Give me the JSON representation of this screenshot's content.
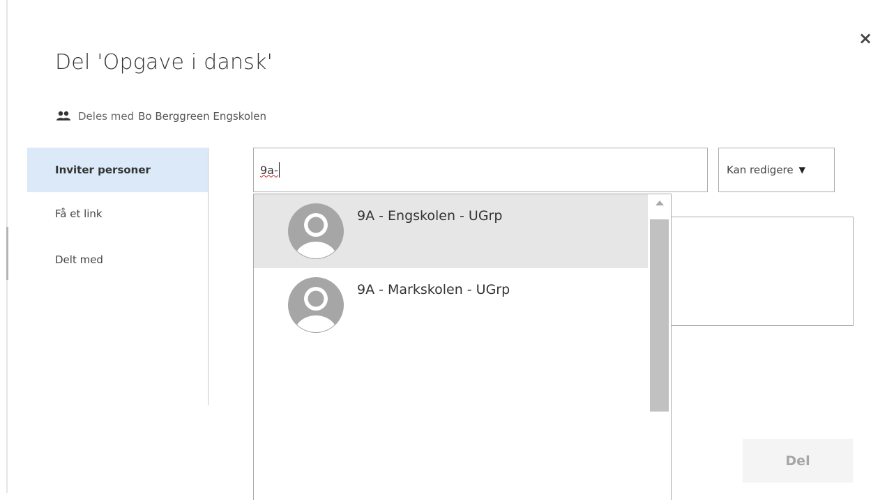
{
  "dialog": {
    "title": "Del 'Opgave i dansk'",
    "close_symbol": "×",
    "shared": {
      "icon": "people-icon",
      "label": "Deles med",
      "owner": "Bo Berggreen Engskolen"
    }
  },
  "nav": {
    "items": [
      {
        "label": "Inviter personer",
        "active": true
      },
      {
        "label": "Få et link",
        "active": false
      },
      {
        "label": "Delt med",
        "active": false
      }
    ]
  },
  "invite": {
    "search_value": "9a-",
    "permission": "Kan redigere",
    "suggestions": [
      {
        "name": "9A - Engskolen - UGrp",
        "avatar": "person-avatar-icon",
        "highlighted": true
      },
      {
        "name": "9A - Markskolen - UGrp",
        "avatar": "person-avatar-icon",
        "highlighted": false
      }
    ],
    "share_button": "Del"
  },
  "colors": {
    "nav_active_bg": "#dbe9f8",
    "highlight_bg": "#e6e6e6",
    "disabled_button_bg": "#f4f4f4"
  }
}
